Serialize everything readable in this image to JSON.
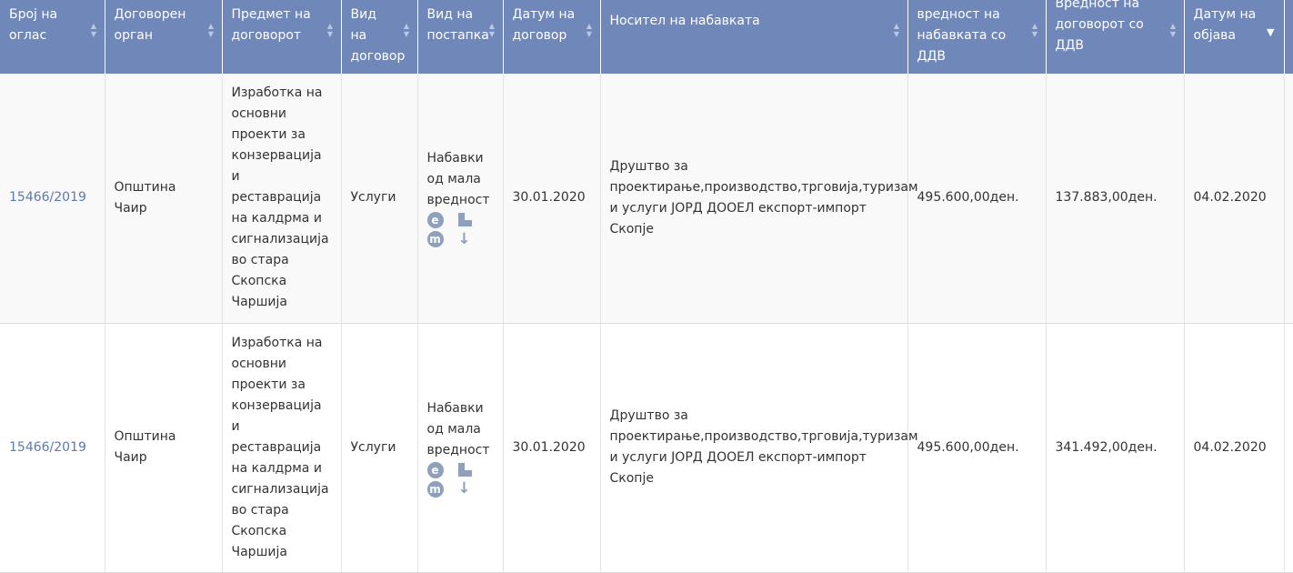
{
  "headers": [
    "Број на оглас",
    "Договорен орган",
    "Предмет на договорот",
    "Вид на договор",
    "Вид на постапка",
    "Датум на договор",
    "Носител на набавката",
    "вредност на набавката со ДДВ",
    "Вредност на договорот со ДДВ",
    "Датум на објава"
  ],
  "rows": [
    {
      "number": "15466/2019",
      "authority": "Општина Чаир",
      "subject": "Изработка на основни проекти за конзервација и реставрација на калдрма и сигнализација во стара Скопска Чаршија",
      "contract_type": "Услуги",
      "procedure": "Набавки од мала вредност",
      "contract_date": "30.01.2020",
      "supplier": "Друштво за проектирање,производство,трговија,туризам и услуги ЈОРД ДООЕЛ експорт-импорт Скопје",
      "estimated_value": "495.600,00ден.",
      "contract_value": "137.883,00ден.",
      "publish_date": "04.02.2020"
    },
    {
      "number": "15466/2019",
      "authority": "Општина Чаир",
      "subject": "Изработка на основни проекти за конзервација и реставрација на калдрма и сигнализација во стара Скопска Чаршија",
      "contract_type": "Услуги",
      "procedure": "Набавки од мала вредност",
      "contract_date": "30.01.2020",
      "supplier": "Друштво за проектирање,производство,трговија,туризам и услуги ЈОРД ДООЕЛ експорт-импорт Скопје",
      "estimated_value": "495.600,00ден.",
      "contract_value": "341.492,00ден.",
      "publish_date": "04.02.2020"
    }
  ],
  "icons": {
    "e_glyph": "e",
    "m_glyph": "m",
    "arrow_glyph": "↓",
    "sort_glyph": "▲▼",
    "sort_active_glyph": "▼"
  },
  "colors": {
    "header_bg": "#6f87b9",
    "link": "#5b7ab0",
    "icon": "#8fa0bd"
  }
}
